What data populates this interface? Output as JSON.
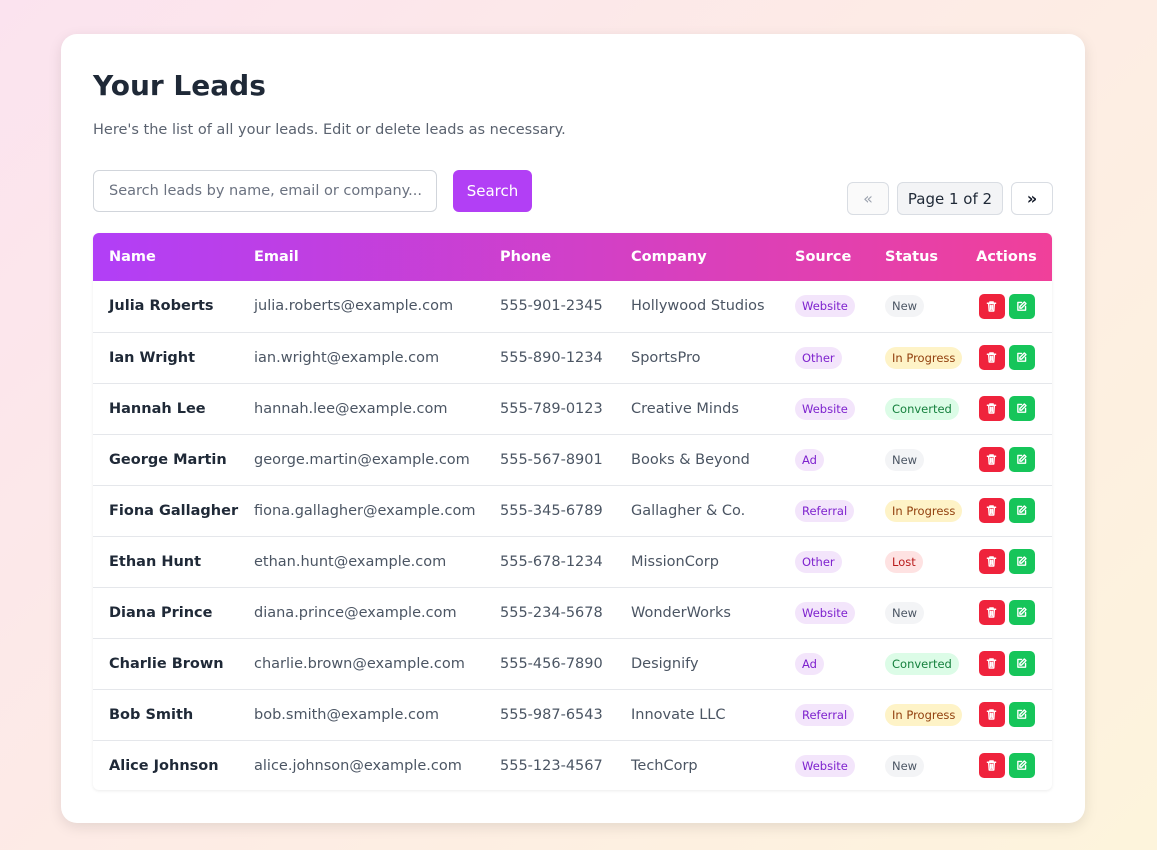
{
  "page": {
    "title": "Your Leads",
    "subtitle": "Here's the list of all your leads. Edit or delete leads as necessary."
  },
  "search": {
    "placeholder": "Search leads by name, email or company...",
    "value": "",
    "button_label": "Search"
  },
  "pagination": {
    "prev_label": "«",
    "info": "Page 1 of 2",
    "next_label": "»"
  },
  "table": {
    "columns": [
      "Name",
      "Email",
      "Phone",
      "Company",
      "Source",
      "Status",
      "Actions"
    ],
    "rows": [
      {
        "name": "Julia Roberts",
        "email": "julia.roberts@example.com",
        "phone": "555-901-2345",
        "company": "Hollywood Studios",
        "source": "Website",
        "status": "New"
      },
      {
        "name": "Ian Wright",
        "email": "ian.wright@example.com",
        "phone": "555-890-1234",
        "company": "SportsPro",
        "source": "Other",
        "status": "In Progress"
      },
      {
        "name": "Hannah Lee",
        "email": "hannah.lee@example.com",
        "phone": "555-789-0123",
        "company": "Creative Minds",
        "source": "Website",
        "status": "Converted"
      },
      {
        "name": "George Martin",
        "email": "george.martin@example.com",
        "phone": "555-567-8901",
        "company": "Books & Beyond",
        "source": "Ad",
        "status": "New"
      },
      {
        "name": "Fiona Gallagher",
        "email": "fiona.gallagher@example.com",
        "phone": "555-345-6789",
        "company": "Gallagher & Co.",
        "source": "Referral",
        "status": "In Progress"
      },
      {
        "name": "Ethan Hunt",
        "email": "ethan.hunt@example.com",
        "phone": "555-678-1234",
        "company": "MissionCorp",
        "source": "Other",
        "status": "Lost"
      },
      {
        "name": "Diana Prince",
        "email": "diana.prince@example.com",
        "phone": "555-234-5678",
        "company": "WonderWorks",
        "source": "Website",
        "status": "New"
      },
      {
        "name": "Charlie Brown",
        "email": "charlie.brown@example.com",
        "phone": "555-456-7890",
        "company": "Designify",
        "source": "Ad",
        "status": "Converted"
      },
      {
        "name": "Bob Smith",
        "email": "bob.smith@example.com",
        "phone": "555-987-6543",
        "company": "Innovate LLC",
        "source": "Referral",
        "status": "In Progress"
      },
      {
        "name": "Alice Johnson",
        "email": "alice.johnson@example.com",
        "phone": "555-123-4567",
        "company": "TechCorp",
        "source": "Website",
        "status": "New"
      }
    ]
  },
  "icons": {
    "delete": "trash-icon",
    "edit": "edit-icon"
  },
  "colors": {
    "accent": "#b23ff5",
    "header_gradient_start": "#b13ff7",
    "header_gradient_end": "#f0409a",
    "delete": "#ef233c",
    "edit": "#16c55a"
  }
}
